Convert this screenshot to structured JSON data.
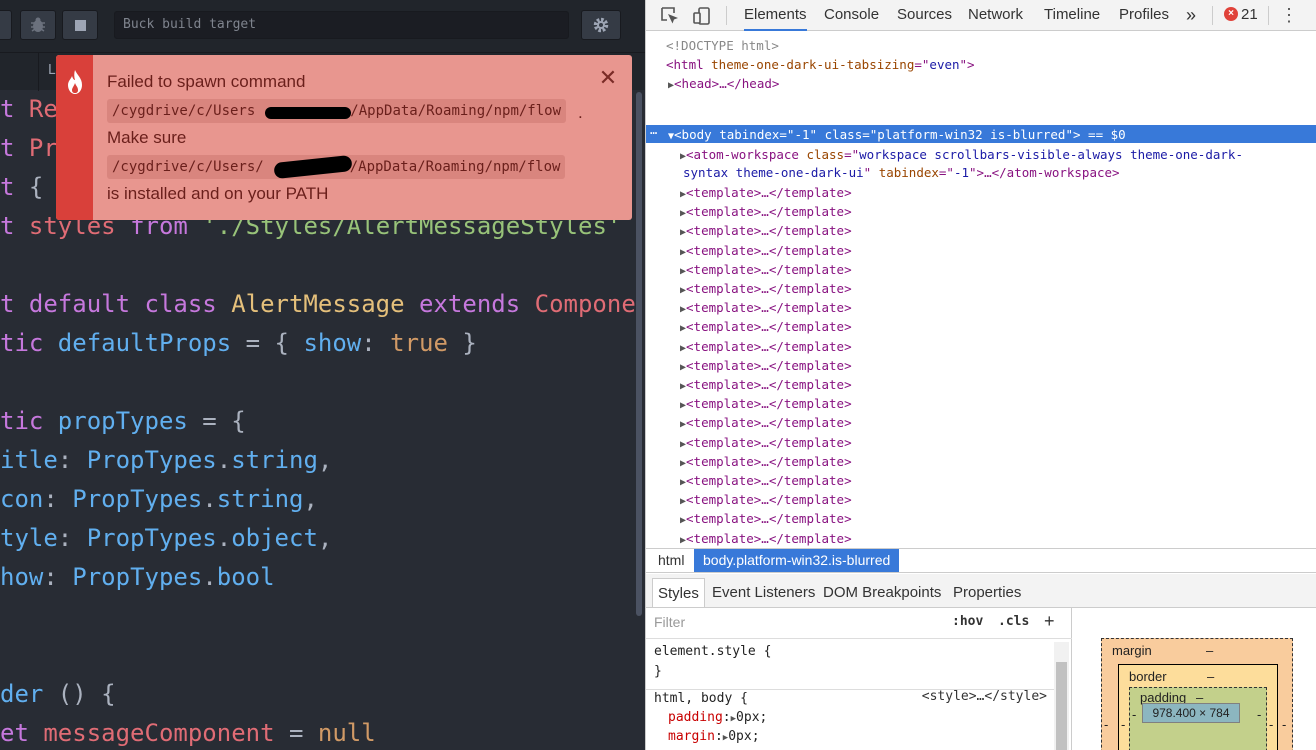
{
  "editor": {
    "toolbar": {
      "bug_icon": "bug-icon",
      "stop_icon": "stop-icon",
      "buck_placeholder": "Buck build target",
      "gear_icon": "gear-icon"
    },
    "tab_fragment": "L",
    "code_lines": [
      {
        "parts": [
          [
            "k",
            "t "
          ],
          [
            "p",
            "Re"
          ]
        ]
      },
      {
        "parts": [
          [
            "k",
            "t "
          ],
          [
            "p",
            "Pr"
          ]
        ]
      },
      {
        "parts": [
          [
            "k",
            "t "
          ],
          [
            "plain",
            "{"
          ]
        ]
      },
      {
        "parts": [
          [
            "k",
            "t "
          ],
          [
            "p",
            "styles "
          ],
          [
            "k",
            "from "
          ],
          [
            "s",
            "'./Styles/AlertMessageStyles'"
          ]
        ]
      },
      {
        "parts": []
      },
      {
        "parts": [
          [
            "k",
            "t default class "
          ],
          [
            "c",
            "AlertMessage "
          ],
          [
            "k",
            "extends "
          ],
          [
            "p",
            "Compone"
          ]
        ]
      },
      {
        "parts": [
          [
            "k",
            "tic "
          ],
          [
            "f",
            "defaultProps "
          ],
          [
            "plain",
            "= { "
          ],
          [
            "f",
            "show"
          ],
          [
            "plain",
            ": "
          ],
          [
            "o",
            "true"
          ],
          [
            "plain",
            " }"
          ]
        ]
      },
      {
        "parts": []
      },
      {
        "parts": [
          [
            "k",
            "tic "
          ],
          [
            "f",
            "propTypes "
          ],
          [
            "plain",
            "= {"
          ]
        ]
      },
      {
        "parts": [
          [
            "f",
            "itle"
          ],
          [
            "plain",
            ": "
          ],
          [
            "f",
            "PropTypes"
          ],
          [
            "plain",
            "."
          ],
          [
            "f",
            "string"
          ],
          [
            "plain",
            ","
          ]
        ]
      },
      {
        "parts": [
          [
            "f",
            "con"
          ],
          [
            "plain",
            ": "
          ],
          [
            "f",
            "PropTypes"
          ],
          [
            "plain",
            "."
          ],
          [
            "f",
            "string"
          ],
          [
            "plain",
            ","
          ]
        ]
      },
      {
        "parts": [
          [
            "f",
            "tyle"
          ],
          [
            "plain",
            ": "
          ],
          [
            "f",
            "PropTypes"
          ],
          [
            "plain",
            "."
          ],
          [
            "f",
            "object"
          ],
          [
            "plain",
            ","
          ]
        ]
      },
      {
        "parts": [
          [
            "f",
            "how"
          ],
          [
            "plain",
            ": "
          ],
          [
            "f",
            "PropTypes"
          ],
          [
            "plain",
            "."
          ],
          [
            "f",
            "bool"
          ]
        ]
      },
      {
        "parts": []
      },
      {
        "parts": []
      },
      {
        "parts": [
          [
            "f",
            "der "
          ],
          [
            "plain",
            "() {"
          ]
        ]
      },
      {
        "parts": [
          [
            "k",
            "et "
          ],
          [
            "p",
            "messageComponent "
          ],
          [
            "plain",
            "= "
          ],
          [
            "o",
            "null"
          ]
        ]
      }
    ]
  },
  "notification": {
    "line1": "Failed to spawn command",
    "code1_a": "/cygdrive/c/Users",
    "code1_b": "/AppData/Roaming/npm/flow",
    "code1_tail": ".",
    "line2": "Make sure",
    "code2_a": "/cygdrive/c/Users/",
    "code2_b": "/AppData/Roaming/npm/flow",
    "line3": "is installed and on your PATH",
    "close": "✕"
  },
  "devtools": {
    "tabs": [
      "Elements",
      "Console",
      "Sources",
      "Network",
      "Timeline",
      "Profiles"
    ],
    "active_tab": "Elements",
    "more": "»",
    "error_count": "21",
    "dom_lines": [
      {
        "indent": 0,
        "html": "<span class='gr'>&lt;!DOCTYPE html&gt;</span>"
      },
      {
        "indent": 0,
        "html": "<span class='tg'>&lt;html </span><span class='an'>theme-one-dark-ui-tabsizing</span><span class='tg'>=\"</span><span class='av'>even</span><span class='tg'>\"&gt;</span>"
      },
      {
        "indent": 1,
        "tri": true,
        "html": "<span class='tg'>&lt;head&gt;</span>…<span class='tg'>&lt;/head&gt;</span>"
      },
      {
        "indent": 1,
        "tri": true,
        "open": true,
        "selected": true,
        "html": "<span class='tg'>&lt;body </span><span class='an'>tabindex</span><span class='tg'>=\"</span><span class='av'>-1</span><span class='tg'>\" </span><span class='an'>class</span><span class='tg'>=\"</span><span class='av'>platform-win32 is-blurred</span><span class='tg'>\"&gt;</span><span class='gr'> == $0</span>"
      },
      {
        "indent": 2,
        "tri": true,
        "html": "<span class='tg'>&lt;atom-workspace </span><span class='an'>class</span><span class='tg'>=\"</span><span class='av'>workspace scrollbars-visible-always theme-one-dark-</span>"
      },
      {
        "indent": 2,
        "wrap": true,
        "html": "<span class='av'>syntax theme-one-dark-ui</span><span class='tg'>\" </span><span class='an'>tabindex</span><span class='tg'>=\"</span><span class='av'>-1</span><span class='tg'>\"&gt;</span>…<span class='tg'>&lt;/atom-workspace&gt;</span>"
      }
    ],
    "template_line": "&lt;template&gt;…&lt;/template&gt;",
    "template_count": 21,
    "crumbs": [
      "html",
      "body.platform-win32.is-blurred"
    ],
    "sub_tabs": [
      "Styles",
      "Event Listeners",
      "DOM Breakpoints",
      "Properties"
    ],
    "active_sub_tab": "Styles",
    "filter_placeholder": "Filter",
    "hov": ":hov",
    "cls": ".cls",
    "plus": "+",
    "style_rules": {
      "element_style": "element.style {",
      "close_brace": "}",
      "selector": "html, body {",
      "source": "<style>…</style>",
      "padding_prop": "padding",
      "padding_val": "0px;",
      "margin_prop": "margin",
      "margin_val": "0px;"
    },
    "box_model": {
      "margin_label": "margin",
      "margin_val": "–",
      "border_label": "border",
      "border_val": "–",
      "padding_label": "padding",
      "padding_val": "–",
      "content": "978.400 × 784",
      "dash": "-"
    }
  }
}
